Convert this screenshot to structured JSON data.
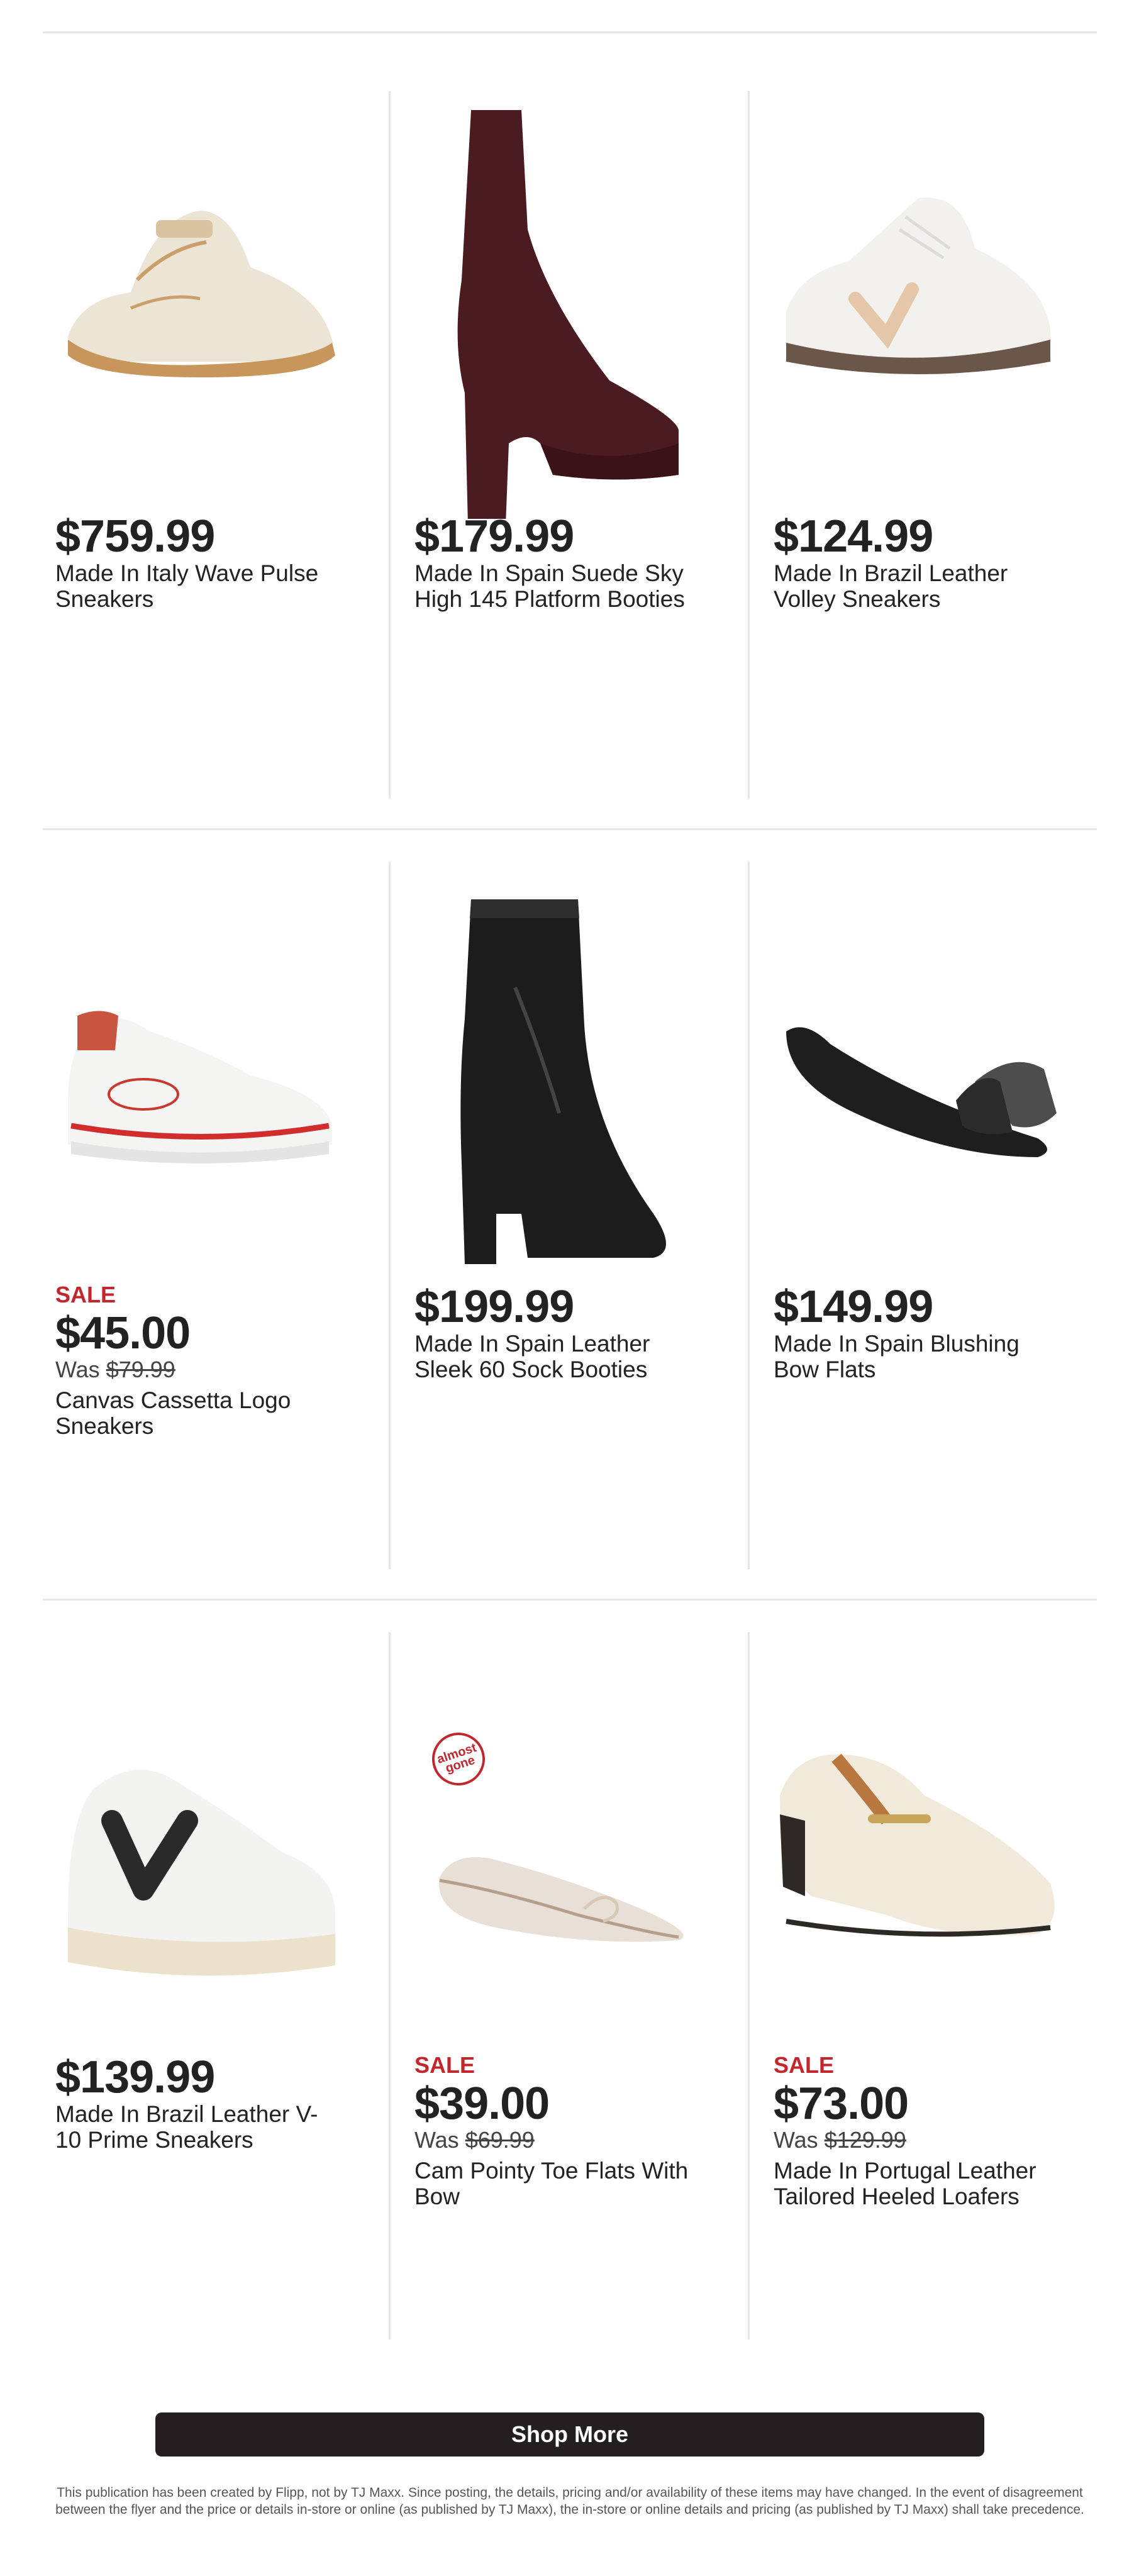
{
  "products": [
    {
      "price": "$759.99",
      "title": "Made In Italy Wave Pulse Sneakers",
      "image": "cream sneaker"
    },
    {
      "price": "$179.99",
      "title": "Made In Spain Suede Sky High 145 Platform Booties",
      "image": "burgundy platform bootie"
    },
    {
      "price": "$124.99",
      "title": "Made In Brazil Leather Volley Sneakers",
      "image": "white leather sneaker"
    },
    {
      "sale": "SALE",
      "price": "$45.00",
      "was_label": "Was",
      "was_price": "$79.99",
      "title": "Canvas Cassetta Logo Sneakers",
      "image": "white red sneaker"
    },
    {
      "price": "$199.99",
      "title": "Made In Spain Leather Sleek 60 Sock Booties",
      "image": "black sock bootie"
    },
    {
      "price": "$149.99",
      "title": "Made In Spain Blushing Bow Flats",
      "image": "black bow flat"
    },
    {
      "price": "$139.99",
      "title": "Made In Brazil Leather V-10 Prime Sneakers",
      "image": "white V sneaker"
    },
    {
      "sale": "SALE",
      "price": "$39.00",
      "was_label": "Was",
      "was_price": "$69.99",
      "title": "Cam Pointy Toe Flats With Bow",
      "badge": "almost gone",
      "image": "mesh flat"
    },
    {
      "sale": "SALE",
      "price": "$73.00",
      "was_label": "Was",
      "was_price": "$129.99",
      "title": "Made In Portugal Leather Tailored Heeled Loafers",
      "image": "cream loafer"
    }
  ],
  "shop_more": "Shop More",
  "disclaimer": "This publication has been created by Flipp, not by TJ Maxx. Since posting, the details, pricing and/or availability of these items may have changed. In the event of disagreement between the flyer and the price or details in-store or online (as published by TJ Maxx), the in-store or online details and pricing (as published by TJ Maxx) shall take precedence.",
  "colors": {
    "sale": "#c1272d",
    "button": "#231f20",
    "divider": "#e6e6e6"
  }
}
